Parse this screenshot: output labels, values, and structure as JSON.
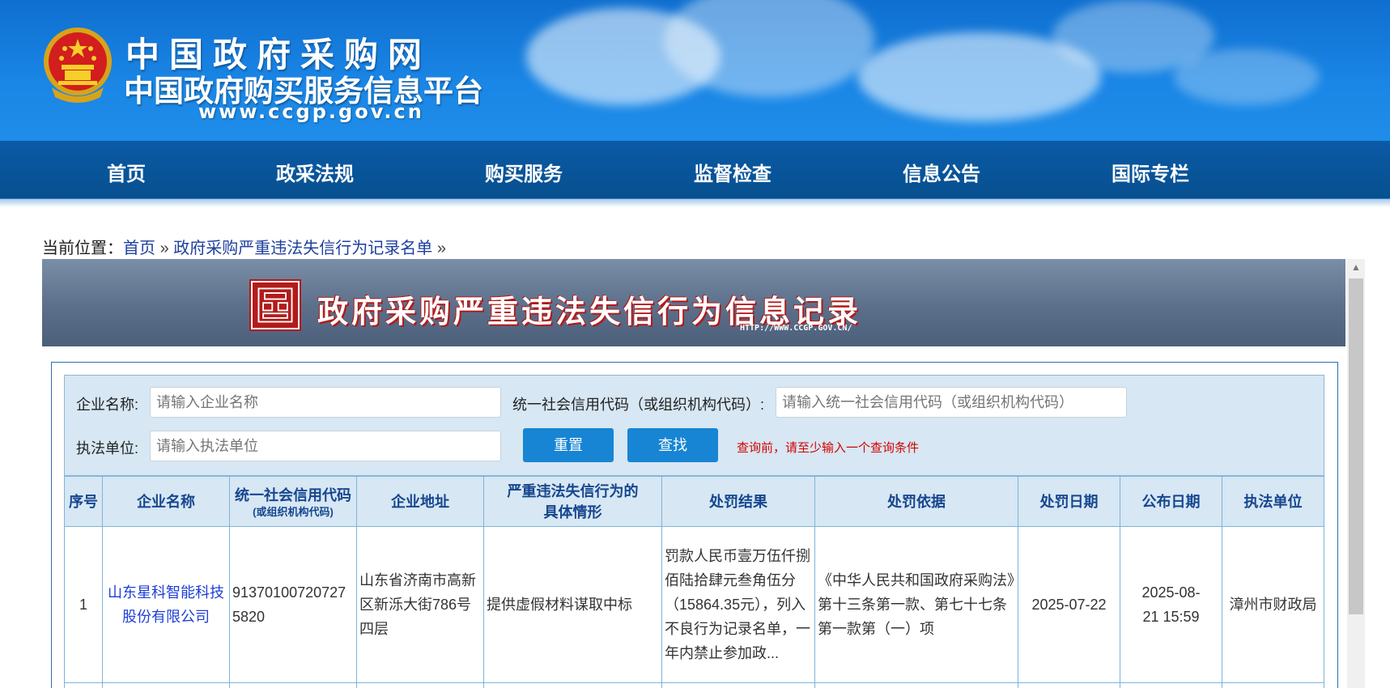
{
  "header": {
    "title": "中国政府采购网",
    "subtitle": "中国政府购买服务信息平台",
    "url": "www.ccgp.gov.cn",
    "logo_icon": "national-emblem"
  },
  "nav": {
    "items": [
      "首页",
      "政采法规",
      "购买服务",
      "监督检查",
      "信息公告",
      "国际专栏"
    ]
  },
  "breadcrumb": {
    "prefix": "当前位置：",
    "items": [
      "首页",
      "政府采购严重违法失信行为记录名单"
    ],
    "separator": "»"
  },
  "section": {
    "title": "政府采购严重违法失信行为信息记录",
    "url": "HTTP://WWW.CCGP.GOV.CN/"
  },
  "search": {
    "company_label": "企业名称:",
    "company_placeholder": "请输入企业名称",
    "code_label": "统一社会信用代码（或组织机构代码）:",
    "code_placeholder": "请输入统一社会信用代码（或组织机构代码）",
    "agency_label": "执法单位:",
    "agency_placeholder": "请输入执法单位",
    "reset_label": "重置",
    "search_label": "查找",
    "hint": "查询前，请至少输入一个查询条件"
  },
  "table": {
    "headers": {
      "seq": "序号",
      "company": "企业名称",
      "code": "统一社会信用代码",
      "code_sub": "(或组织机构代码)",
      "address": "企业地址",
      "situation": "严重违法失信行为的具体情形",
      "result": "处罚结果",
      "basis": "处罚依据",
      "penalty_date": "处罚日期",
      "publish_date": "公布日期",
      "agency": "执法单位"
    },
    "rows": [
      {
        "seq": "1",
        "company": "山东星科智能科技股份有限公司",
        "code": "913701007207275820",
        "address": "山东省济南市高新区新泺大街786号四层",
        "situation": "提供虚假材料谋取中标",
        "result": "罚款人民币壹万伍仟捌佰陆拾肆元叁角伍分（15864.35元），列入不良行为记录名单，一年内禁止参加政...",
        "basis": "《中华人民共和国政府采购法》第十三条第一款、第七十七条第一款第（一）项",
        "penalty_date": "2025-07-22",
        "publish_date": "2025-08-21 15:59",
        "agency": "漳州市财政局"
      }
    ]
  },
  "colors": {
    "banner": "#1a86e6",
    "nav": "#07508f",
    "button": "#1785d4",
    "header_cell": "#d7e7f3",
    "hint": "#d60000"
  }
}
